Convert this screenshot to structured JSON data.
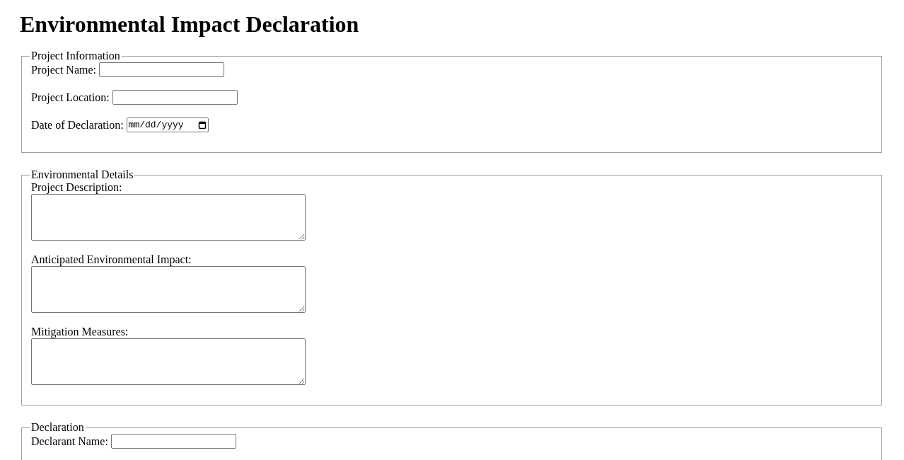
{
  "title": "Environmental Impact Declaration",
  "sections": [
    {
      "legend": "Project Information",
      "fields": [
        {
          "kind": "text",
          "label": "Project Name:"
        },
        {
          "kind": "text",
          "label": "Project Location:"
        },
        {
          "kind": "date",
          "label": "Date of Declaration:",
          "placeholder": "mm/dd/yyyy"
        }
      ]
    },
    {
      "legend": "Environmental Details",
      "fields": [
        {
          "kind": "textarea",
          "label": "Project Description:"
        },
        {
          "kind": "textarea",
          "label": "Anticipated Environmental Impact:"
        },
        {
          "kind": "textarea",
          "label": "Mitigation Measures:"
        }
      ]
    },
    {
      "legend": "Declaration",
      "fields": [
        {
          "kind": "text",
          "label": "Declarant Name:"
        }
      ]
    }
  ]
}
